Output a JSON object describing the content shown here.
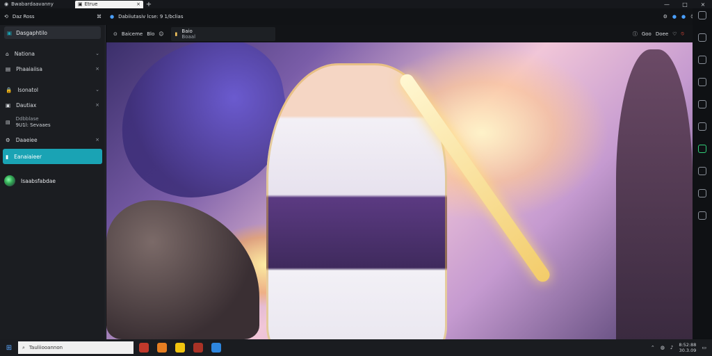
{
  "titlebar": {
    "app_title": "Bwabardaavanny",
    "active_tab": "Etrue",
    "new_tab": "+",
    "controls": [
      "—",
      "□",
      "×"
    ]
  },
  "toolbar": {
    "left_text": "Daz Ross",
    "address": "Dabiiutasiv lcse: 9 1/bclias",
    "right_icons": [
      "settings-icon",
      "edge-icon",
      "browser-icon",
      "profile-icon",
      "window-icon"
    ]
  },
  "sidebar": {
    "header": "Dasgaphtilo",
    "items": [
      {
        "label": "Nationa"
      },
      {
        "label": "Phaaiaiisa"
      },
      {
        "label": "Isonatol"
      },
      {
        "label": "Dautiax"
      },
      {
        "label_line1": "Ddbblase",
        "label_line2": "9U1l: Sevaaes"
      },
      {
        "label": "Daaeiee"
      },
      {
        "label": "Eanaiaieer"
      }
    ],
    "profile_name": "Isaabsfabdae"
  },
  "content_header": {
    "left_text": "Baiceme",
    "left_badge": "Blo",
    "mid_title_line1": "Baio",
    "mid_title_line2": "Boaal",
    "right_text1": "Goo",
    "right_text2": "Doee"
  },
  "taskbar": {
    "search_placeholder": "Tauliiooannon",
    "clock_time": "8:52:88",
    "clock_date": "30.3.09"
  },
  "colors": {
    "accent": "#1aa3b4",
    "sidebar_bg": "#1b1d21",
    "topbar_bg": "#16181c"
  }
}
